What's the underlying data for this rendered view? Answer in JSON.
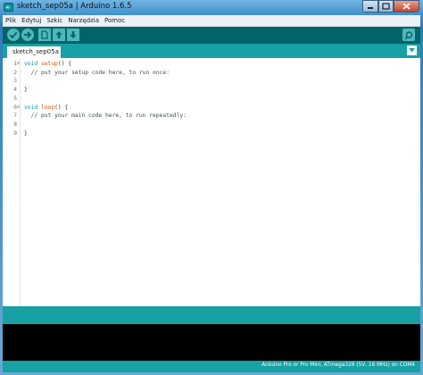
{
  "window": {
    "title": "sketch_sep05a | Arduino 1.6.5",
    "app_icon_text": "∞",
    "minimize_icon": "minimize-icon",
    "maximize_icon": "maximize-icon",
    "close_icon": "close-icon"
  },
  "menu": [
    "Plik",
    "Edytuj",
    "Szkic",
    "Narzędzia",
    "Pomoc"
  ],
  "toolbar": {
    "buttons": [
      "verify-icon",
      "upload-icon",
      "new-icon",
      "open-icon",
      "save-icon"
    ],
    "serial_monitor_icon": "magnifier-icon"
  },
  "tabs": {
    "active": "sketch_sep05a",
    "menu_icon": "triangle-down-icon"
  },
  "editor": {
    "line_numbers": [
      "1",
      "2",
      "3",
      "4",
      "5",
      "6",
      "7",
      "8",
      "9"
    ],
    "lines": [
      {
        "kw": "void",
        "fn": "setup",
        "rest": "() {"
      },
      {
        "comment": "  // put your setup code here, to run once:"
      },
      {
        "text": ""
      },
      {
        "text": "}"
      },
      {
        "text": ""
      },
      {
        "kw": "void",
        "fn": "loop",
        "rest": "() {"
      },
      {
        "comment": "  // put your main code here, to run repeatedly:"
      },
      {
        "text": ""
      },
      {
        "text": "}"
      }
    ]
  },
  "status": {
    "board": "Arduino Pro or Pro Mini, ATmega328 (5V, 16 MHz) on COM4"
  },
  "colors": {
    "toolbar": "#006468",
    "tabbar": "#17a1a5",
    "keyword": "#00979c",
    "function": "#d35400",
    "console": "#000000"
  }
}
